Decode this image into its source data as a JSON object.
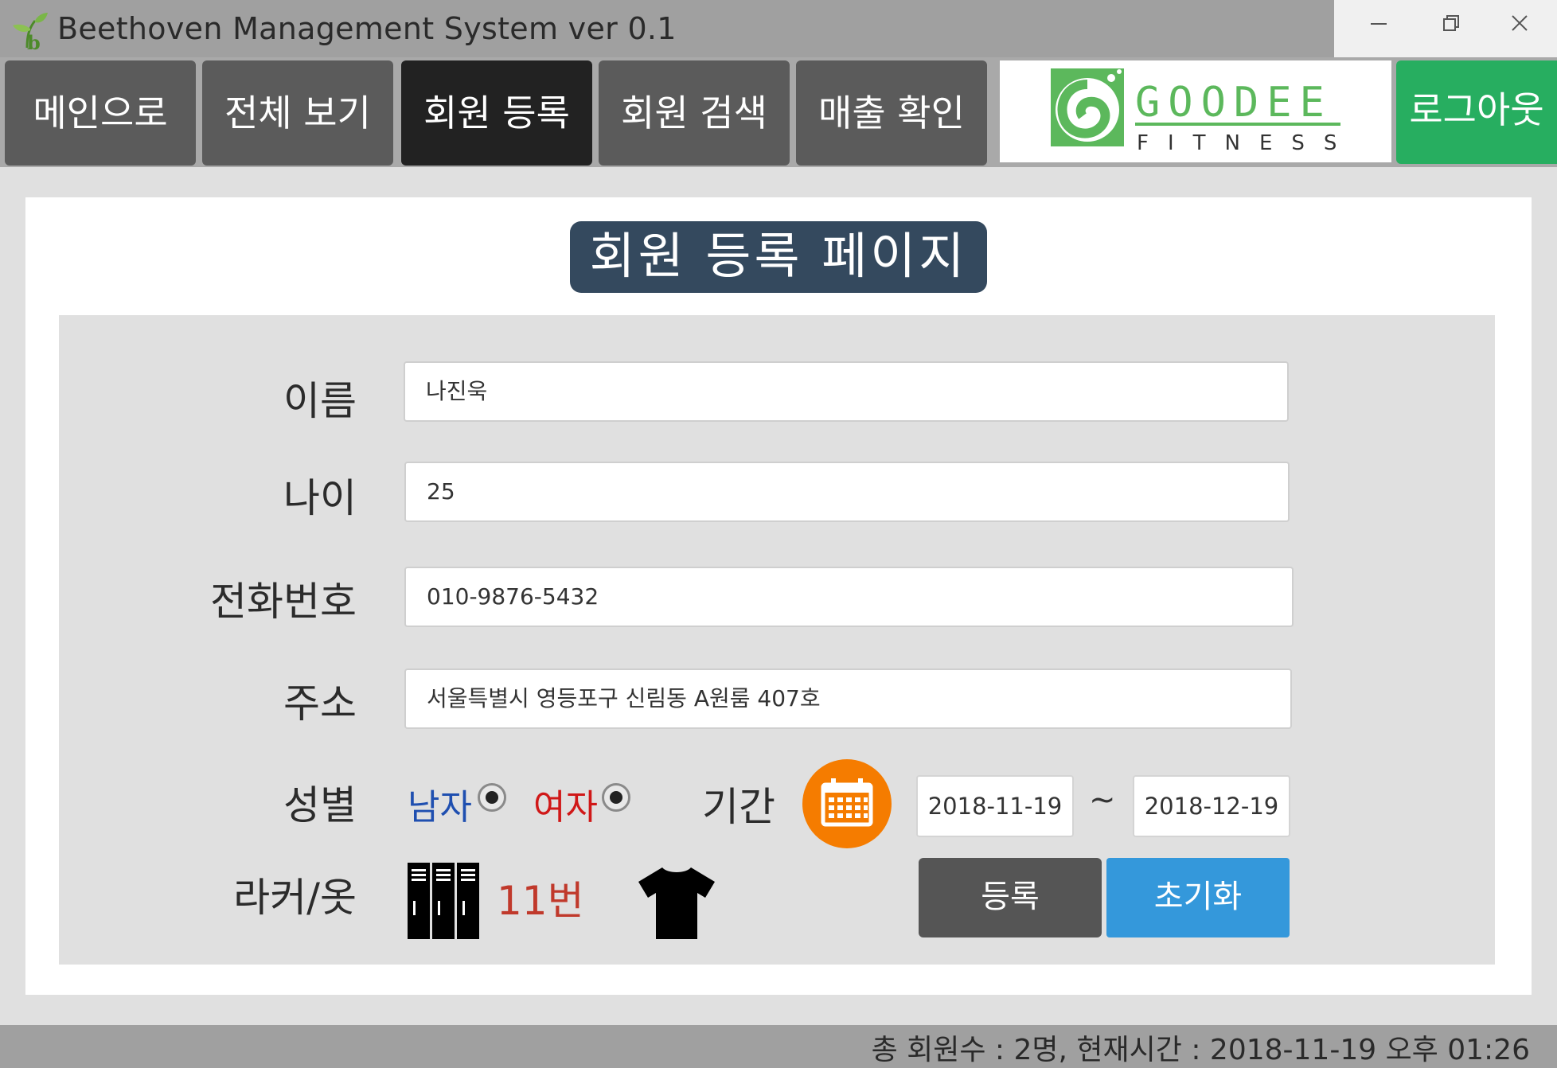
{
  "window": {
    "title": "Beethoven Management System ver 0.1",
    "controls": [
      "minimize-icon",
      "restore-icon",
      "close-icon"
    ]
  },
  "nav": {
    "items": [
      {
        "label": "메인으로",
        "active": false
      },
      {
        "label": "전체 보기",
        "active": false
      },
      {
        "label": "회원 등록",
        "active": true
      },
      {
        "label": "회원 검색",
        "active": false
      },
      {
        "label": "매출 확인",
        "active": false
      }
    ],
    "logo": {
      "line1": "GOODEE",
      "line2": "FITNESS"
    },
    "logout_label": "로그아웃"
  },
  "page": {
    "title": "회원 등록 페이지"
  },
  "form": {
    "name": {
      "label": "이름",
      "value": "나진욱"
    },
    "age": {
      "label": "나이",
      "value": "25"
    },
    "phone": {
      "label": "전화번호",
      "value": "010-9876-5432"
    },
    "address": {
      "label": "주소",
      "value": "서울특별시 영등포구 신림동 A원룸 407호"
    },
    "gender": {
      "label": "성별",
      "male": "남자",
      "female": "여자"
    },
    "period": {
      "label": "기간",
      "start": "2018-11-19",
      "separator": "~",
      "end": "2018-12-19"
    },
    "locker": {
      "label": "라커/옷",
      "number": "11번"
    },
    "buttons": {
      "register": "등록",
      "reset": "초기화"
    }
  },
  "status": {
    "text": "총 회원수 : 2명, 현재시간 : 2018-11-19 오후 01:26"
  },
  "colors": {
    "nav_button": "#5b5b5b",
    "nav_active": "#222222",
    "logout": "#27ae60",
    "title_bg": "#34495e",
    "calendar": "#f57c00",
    "male": "#1f4fb0",
    "female": "#d01818",
    "locker_number": "#c0392b",
    "register": "#555555",
    "reset": "#3498db",
    "logo_green": "#5cb85c"
  }
}
